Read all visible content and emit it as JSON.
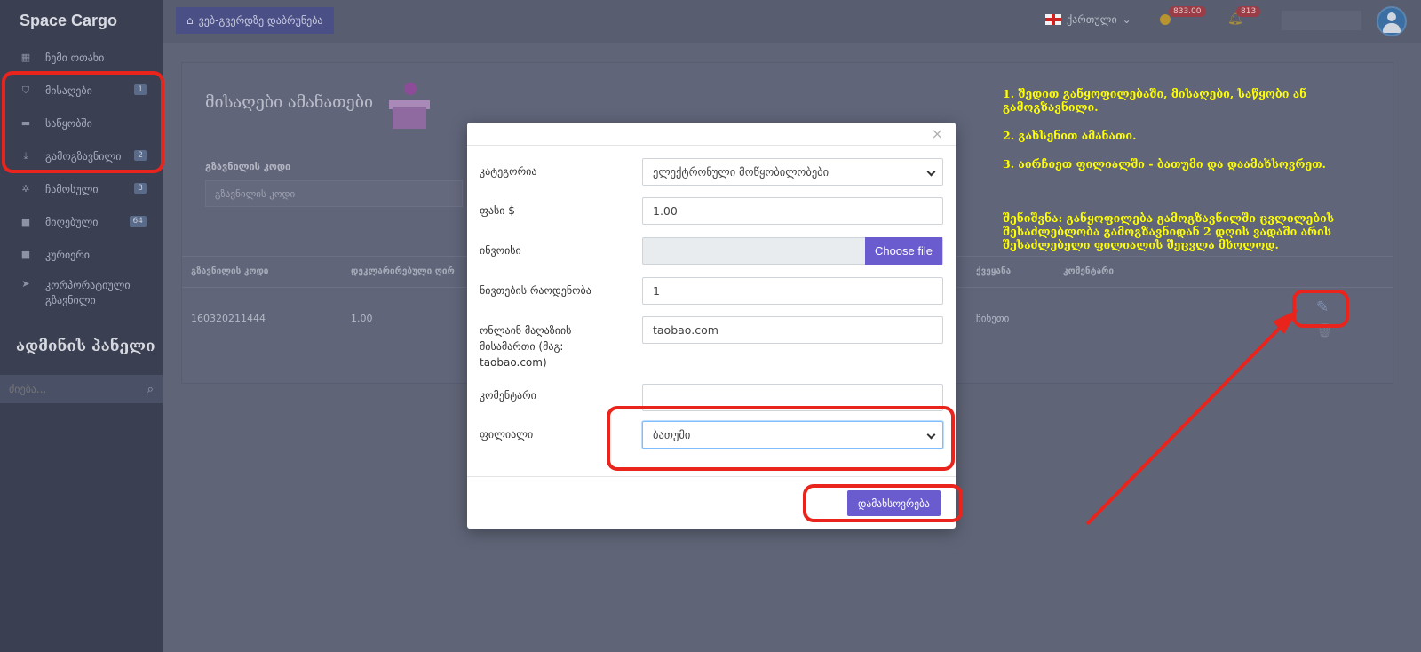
{
  "app": {
    "brand": "Space Cargo"
  },
  "sidebar": {
    "items": [
      {
        "icon": "grid-icon",
        "label": "ჩემი ოთახი",
        "badge": ""
      },
      {
        "icon": "shield-icon",
        "label": "მისაღები",
        "badge": "1"
      },
      {
        "icon": "briefcase-icon",
        "label": "საწყობში",
        "badge": ""
      },
      {
        "icon": "download-icon",
        "label": "გამოგზავნილი",
        "badge": "2"
      },
      {
        "icon": "wrench-icon",
        "label": "ჩამოსული",
        "badge": "3"
      },
      {
        "icon": "square-icon",
        "label": "მიღებული",
        "badge": "64"
      },
      {
        "icon": "square-icon",
        "label": "კურიერი",
        "badge": ""
      },
      {
        "icon": "send-icon",
        "label": "კორპორატიული გზავნილი",
        "badge": ""
      }
    ],
    "admin_title": "ადმინის პანელი",
    "search_placeholder": "ძიება..."
  },
  "topbar": {
    "home_button": "ვებ-გვერდზე დაბრუნება",
    "language": "ქართული",
    "balance": "833.00",
    "notifications": "813"
  },
  "page": {
    "title": "მისაღები ამანათები",
    "code_label": "გზავნილის კოდი",
    "code_placeholder": "გზავნილის კოდი",
    "columns": [
      "გზავნილის კოდი",
      "დეკლარირებული ღირ",
      "ქვეყანა",
      "კომენტარი"
    ],
    "row": {
      "code": "160320211444",
      "value": "1.00",
      "country": "ჩინეთი"
    }
  },
  "instructions": {
    "step1": "1. შედით განყოფილებაში, მისაღები, საწყობი ან გამოგზავნილი.",
    "step2": "2. გახსენით ამანათი.",
    "step3": "3. აირჩიეთ ფილიალში - ბათუმი და დაამახსოვრეთ.",
    "note": "შენიშვნა: განყოფილება გამოგზავნილში ცვლილების შესაძლებლობა გამოგზავნიდან 2 დღის ვადაში არის შესაძლებელი ფილიალის შეცვლა მხოლოდ."
  },
  "modal": {
    "close": "×",
    "category_label": "კატეგორია",
    "category_value": "ელექტრონული მოწყობილობები",
    "price_label": "ფასი $",
    "price_value": "1.00",
    "invoice_label": "ინვოისი",
    "choose_file": "Choose file",
    "quantity_label": "ნივთების რაოდენობა",
    "quantity_value": "1",
    "store_label": "ონლაინ მაღაზიის მისამართი (მაგ: taobao.com)",
    "store_value": "taobao.com",
    "comment_label": "კომენტარი",
    "comment_value": "",
    "branch_label": "ფილიალი",
    "branch_value": "ბათუმი",
    "save_button": "დამახსოვრება"
  },
  "colors": {
    "accent": "#6a5ccf",
    "annotation": "#e8241c",
    "instruction_text": "#ffff00"
  }
}
